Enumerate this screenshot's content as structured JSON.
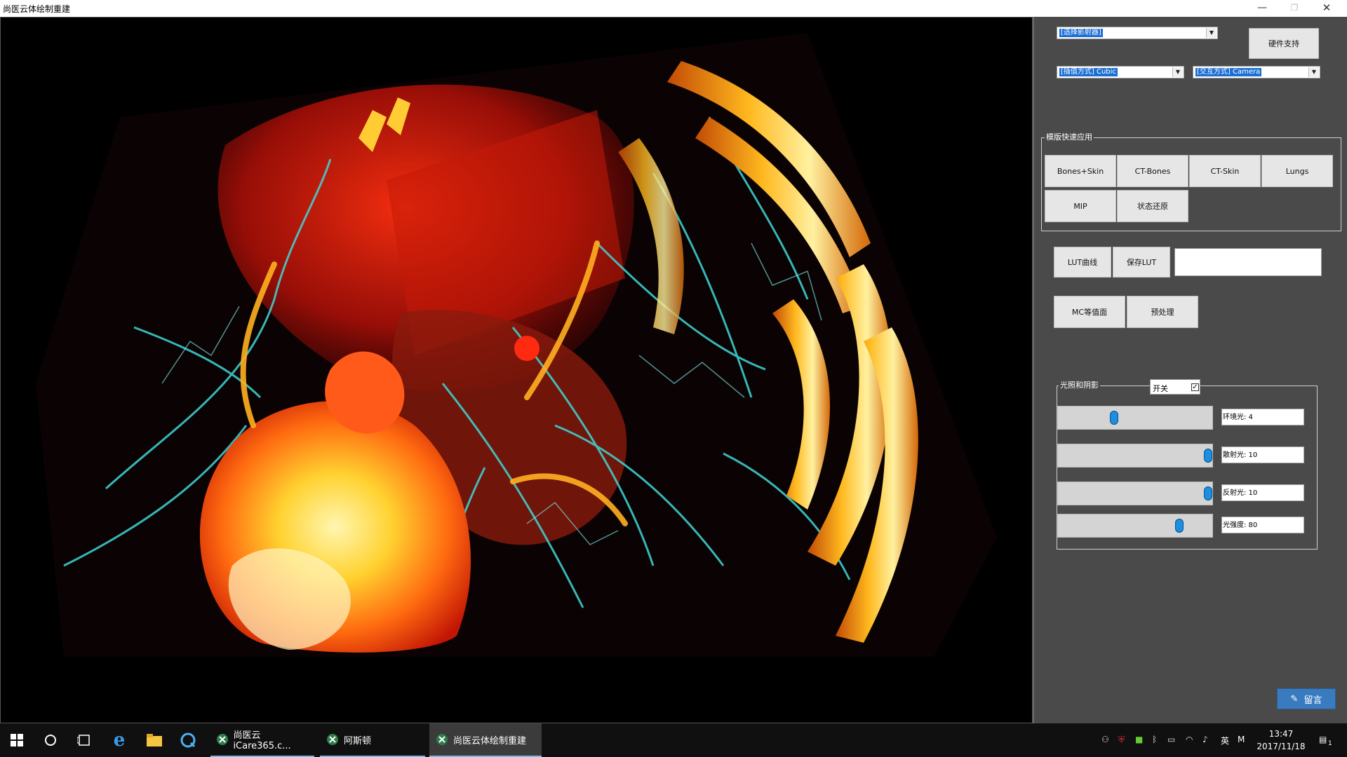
{
  "window": {
    "title": "尚医云体绘制重建",
    "controls": {
      "minimize": "—",
      "maximize": "❐",
      "close": "✕"
    }
  },
  "viewport": {
    "content": "3D volume rendering of chest CT (bones, vessels, lungs)"
  },
  "panel": {
    "combo_mapping": "[选择影射器]",
    "hardware_button": "硬件支持",
    "combo_interpolation": "[插值方式] Cubic",
    "combo_interaction": "[交互方式] Camera",
    "template_group": {
      "title": "模版快速应用",
      "buttons": [
        "Bones+Skin",
        "CT-Bones",
        "CT-Skin",
        "Lungs",
        "MIP",
        "状态还原"
      ]
    },
    "lut_curve_button": "LUT曲线",
    "save_lut_button": "保存LUT",
    "lut_name_value": "",
    "mc_button": "MC等值面",
    "preprocess_button": "预处理",
    "lighting_group": {
      "title": "光照和阴影",
      "toggle_label": "开关",
      "toggle_checked": true,
      "sliders": [
        {
          "label": "环境光: 4",
          "level": 0.35
        },
        {
          "label": "散射光: 10",
          "level": 1.0
        },
        {
          "label": "反射光: 10",
          "level": 1.0
        },
        {
          "label": "光强度: 80",
          "level": 0.8
        }
      ]
    },
    "message_button": "留言"
  },
  "taskbar": {
    "apps": [
      {
        "label": "尚医云 iCare365.c...",
        "active": false
      },
      {
        "label": "阿斯顿",
        "active": false
      },
      {
        "label": "尚医云体绘制重建",
        "active": true
      }
    ],
    "ime": "英",
    "ime2": "M",
    "time": "13:47",
    "date": "2017/11/18",
    "notifications": "1"
  },
  "colors": {
    "panel_bg": "#4a4a4a",
    "slider_thumb": "#1b8fe0",
    "selection": "#1c6fd3",
    "taskbar_bg": "#101010"
  }
}
